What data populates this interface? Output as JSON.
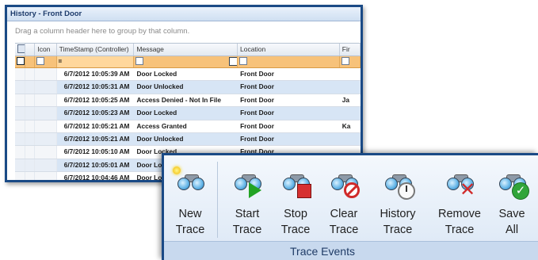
{
  "history": {
    "title": "History - Front Door",
    "group_hint": "Drag a column header here to group by that column.",
    "columns": [
      "Icon",
      "TimeStamp (Controller)",
      "Message",
      "Location",
      "Fir"
    ],
    "filter": {
      "timestamp": "="
    },
    "rows": [
      {
        "ts": "6/7/2012 10:05:39 AM",
        "msg": "Door Locked",
        "loc": "Front Door",
        "first": ""
      },
      {
        "ts": "6/7/2012 10:05:31 AM",
        "msg": "Door Unlocked",
        "loc": "Front Door",
        "first": ""
      },
      {
        "ts": "6/7/2012 10:05:25 AM",
        "msg": "Access Denied - Not In File",
        "loc": "Front Door",
        "first": "Ja"
      },
      {
        "ts": "6/7/2012 10:05:23 AM",
        "msg": "Door Locked",
        "loc": "Front Door",
        "first": ""
      },
      {
        "ts": "6/7/2012 10:05:21 AM",
        "msg": "Access Granted",
        "loc": "Front Door",
        "first": "Ka"
      },
      {
        "ts": "6/7/2012 10:05:21 AM",
        "msg": "Door Unlocked",
        "loc": "Front Door",
        "first": ""
      },
      {
        "ts": "6/7/2012 10:05:10 AM",
        "msg": "Door Locked",
        "loc": "Front Door",
        "first": ""
      },
      {
        "ts": "6/7/2012 10:05:01 AM",
        "msg": "Door Lo",
        "loc": "",
        "first": ""
      },
      {
        "ts": "6/7/2012 10:04:46 AM",
        "msg": "Door Lo",
        "loc": "",
        "first": ""
      }
    ]
  },
  "ribbon": {
    "buttons": [
      {
        "line1": "New",
        "line2": "Trace",
        "icon": "new-trace-icon"
      },
      {
        "line1": "Start",
        "line2": "Trace",
        "icon": "start-trace-icon"
      },
      {
        "line1": "Stop",
        "line2": "Trace",
        "icon": "stop-trace-icon"
      },
      {
        "line1": "Clear",
        "line2": "Trace",
        "icon": "clear-trace-icon"
      },
      {
        "line1": "History",
        "line2": "Trace",
        "icon": "history-trace-icon"
      },
      {
        "line1": "Remove",
        "line2": "Trace",
        "icon": "remove-trace-icon"
      },
      {
        "line1": "Save",
        "line2": "All",
        "icon": "save-all-icon"
      }
    ],
    "group_label": "Trace Events"
  },
  "colors": {
    "window_border": "#1a4a86",
    "filter_row": "#f7c27a",
    "alt_row": "#d7e5f5",
    "ribbon_group": "#c8d9ee"
  }
}
